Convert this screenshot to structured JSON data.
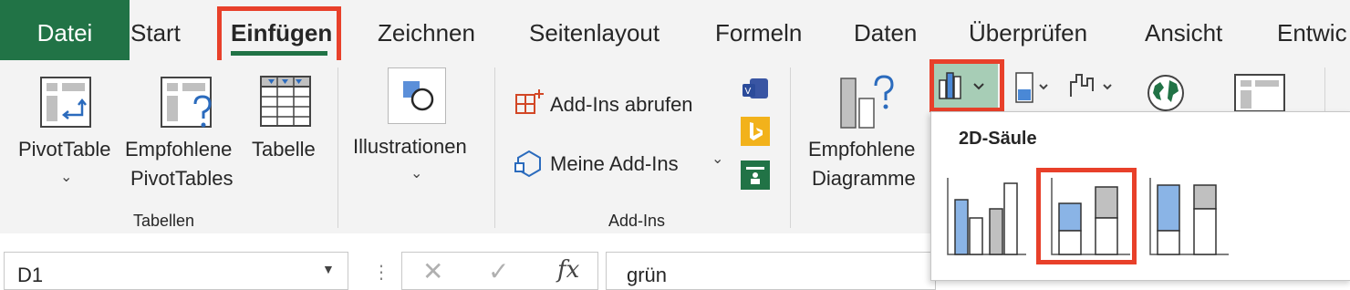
{
  "tabs": [
    "Datei",
    "Start",
    "Einfügen",
    "Zeichnen",
    "Seitenlayout",
    "Formeln",
    "Daten",
    "Überprüfen",
    "Ansicht",
    "Entwic"
  ],
  "ribbon": {
    "tables": {
      "pivot_line1": "PivotTable",
      "recommended_line1": "Empfohlene",
      "recommended_line2": "PivotTables",
      "table": "Tabelle",
      "group": "Tabellen"
    },
    "illustrations": {
      "label": "Illustrationen"
    },
    "addins": {
      "get": "Add-Ins abrufen",
      "mine": "Meine Add-Ins",
      "group": "Add-Ins"
    },
    "charts": {
      "recommended_line1": "Empfohlene",
      "recommended_line2": "Diagramme"
    }
  },
  "namebox": {
    "value": "D1"
  },
  "formula": {
    "value": "grün"
  },
  "dropdown": {
    "title": "2D-Säule"
  },
  "colors": {
    "brand": "#217346",
    "highlight": "#e8402a",
    "bar_blue": "#8ab4e6",
    "bar_gray": "#c0c0c0",
    "selected_bg": "#a7cdb6"
  }
}
